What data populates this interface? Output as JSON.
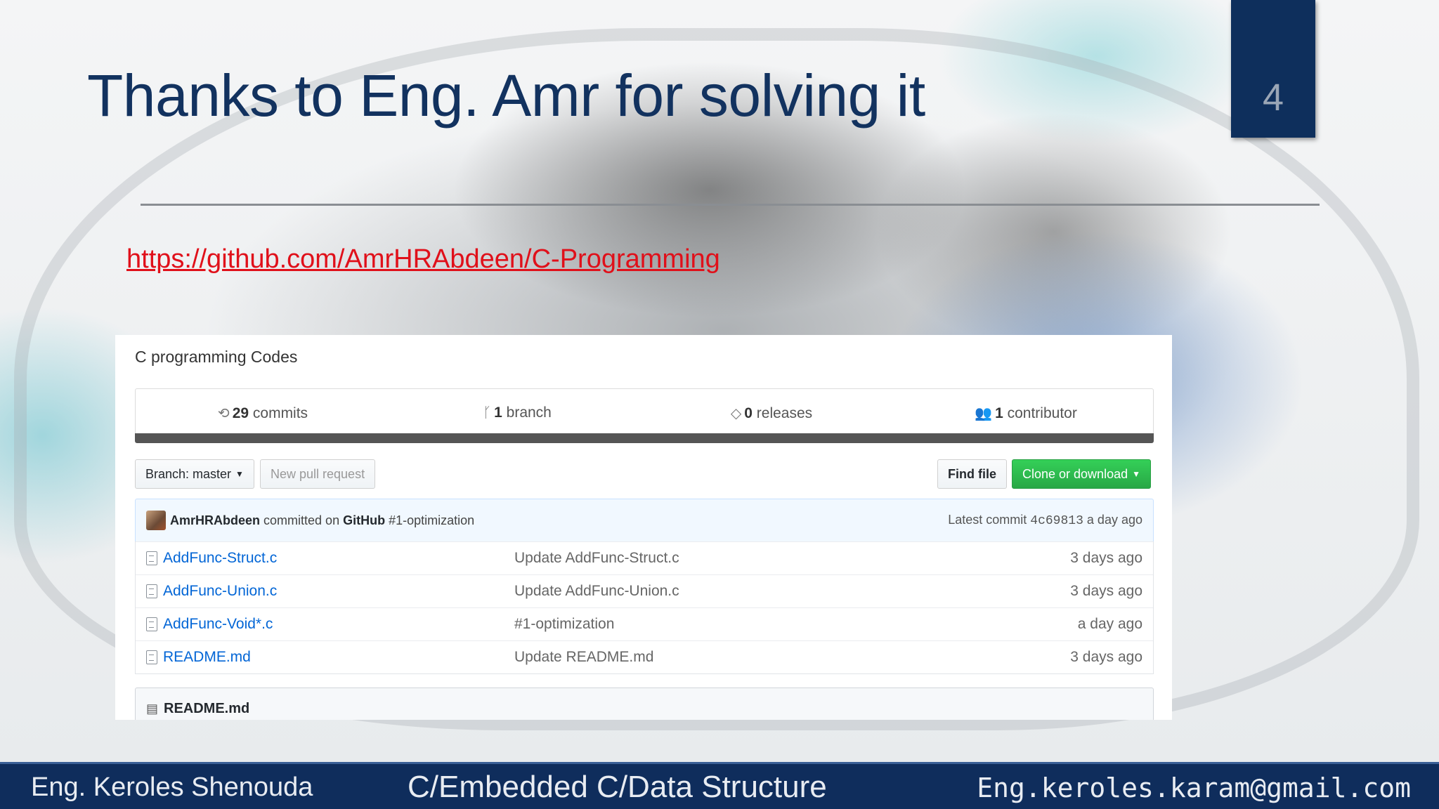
{
  "slide": {
    "title": "Thanks to Eng. Amr for solving it",
    "page_number": "4",
    "link": "https://github.com/AmrHRAbdeen/C-Programming"
  },
  "repo": {
    "description": "C programming Codes",
    "stats": {
      "commits_count": "29",
      "commits_label": "commits",
      "branch_count": "1",
      "branch_label": "branch",
      "releases_count": "0",
      "releases_label": "releases",
      "contributor_count": "1",
      "contributor_label": "contributor"
    },
    "branch_button": "Branch: master",
    "new_pull_request": "New pull request",
    "find_file": "Find file",
    "clone_or_download": "Clone or download",
    "commit": {
      "author": "AmrHRAbdeen",
      "committed_on": "committed on",
      "platform": "GitHub",
      "message": "#1-optimization",
      "latest_label": "Latest commit",
      "hash": "4c69813",
      "age": "a day ago"
    },
    "files": [
      {
        "name": "AddFunc-Struct.c",
        "message": "Update AddFunc-Struct.c",
        "age": "3 days ago"
      },
      {
        "name": "AddFunc-Union.c",
        "message": "Update AddFunc-Union.c",
        "age": "3 days ago"
      },
      {
        "name": "AddFunc-Void*.c",
        "message": "#1-optimization",
        "age": "a day ago"
      },
      {
        "name": "README.md",
        "message": "Update README.md",
        "age": "3 days ago"
      }
    ],
    "readme_title": "README.md"
  },
  "footer": {
    "left": "Eng. Keroles Shenouda",
    "middle": "C/Embedded C/Data Structure",
    "right": "Eng.keroles.karam@gmail.com"
  },
  "colors": {
    "title": "#12325f",
    "footer_bg": "#0f2d5c",
    "link": "#e0101a",
    "clone_button": "#28a745",
    "file_link": "#0366d6"
  },
  "icons": [
    "history-icon",
    "branch-icon",
    "tag-icon",
    "people-icon",
    "file-icon",
    "book-icon",
    "caret-down-icon"
  ]
}
